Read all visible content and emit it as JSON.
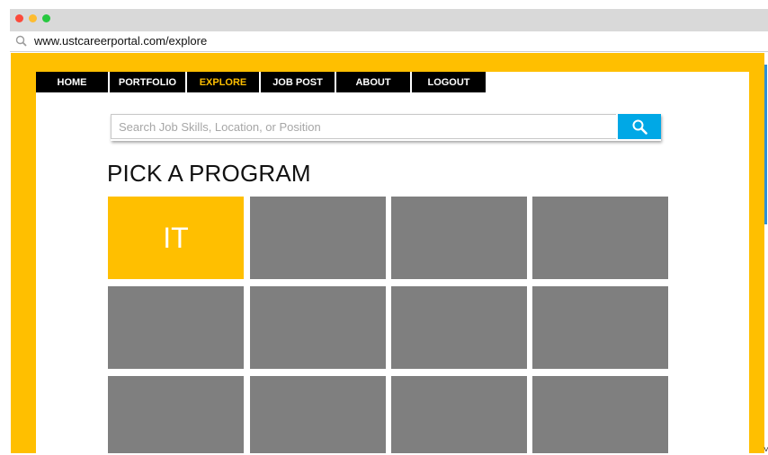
{
  "browser": {
    "url": "www.ustcareerportal.com/explore",
    "search_icon": "search-icon"
  },
  "colors": {
    "accent": "#ffbf00",
    "nav_bg": "#000000",
    "search_button": "#00a8e6",
    "tile": "#7f7f7f",
    "scrollbar": "#2f8fd6"
  },
  "nav": {
    "items": [
      {
        "label": "HOME",
        "active": false
      },
      {
        "label": "PORTFOLIO",
        "active": false
      },
      {
        "label": "EXPLORE",
        "active": true
      },
      {
        "label": "JOB POST",
        "active": false
      },
      {
        "label": "ABOUT",
        "active": false
      },
      {
        "label": "LOGOUT",
        "active": false
      }
    ]
  },
  "search": {
    "placeholder": "Search Job Skills, Location, or Position",
    "value": "",
    "button_icon": "search-icon"
  },
  "section": {
    "title": "PICK A PROGRAM"
  },
  "programs": {
    "tiles": [
      {
        "label": "IT",
        "active": true
      },
      {
        "label": "",
        "active": false
      },
      {
        "label": "",
        "active": false
      },
      {
        "label": "",
        "active": false
      },
      {
        "label": "",
        "active": false
      },
      {
        "label": "",
        "active": false
      },
      {
        "label": "",
        "active": false
      },
      {
        "label": "",
        "active": false
      },
      {
        "label": "",
        "active": false
      },
      {
        "label": "",
        "active": false
      },
      {
        "label": "",
        "active": false
      },
      {
        "label": "",
        "active": false
      }
    ]
  },
  "edge_mark": "˅"
}
